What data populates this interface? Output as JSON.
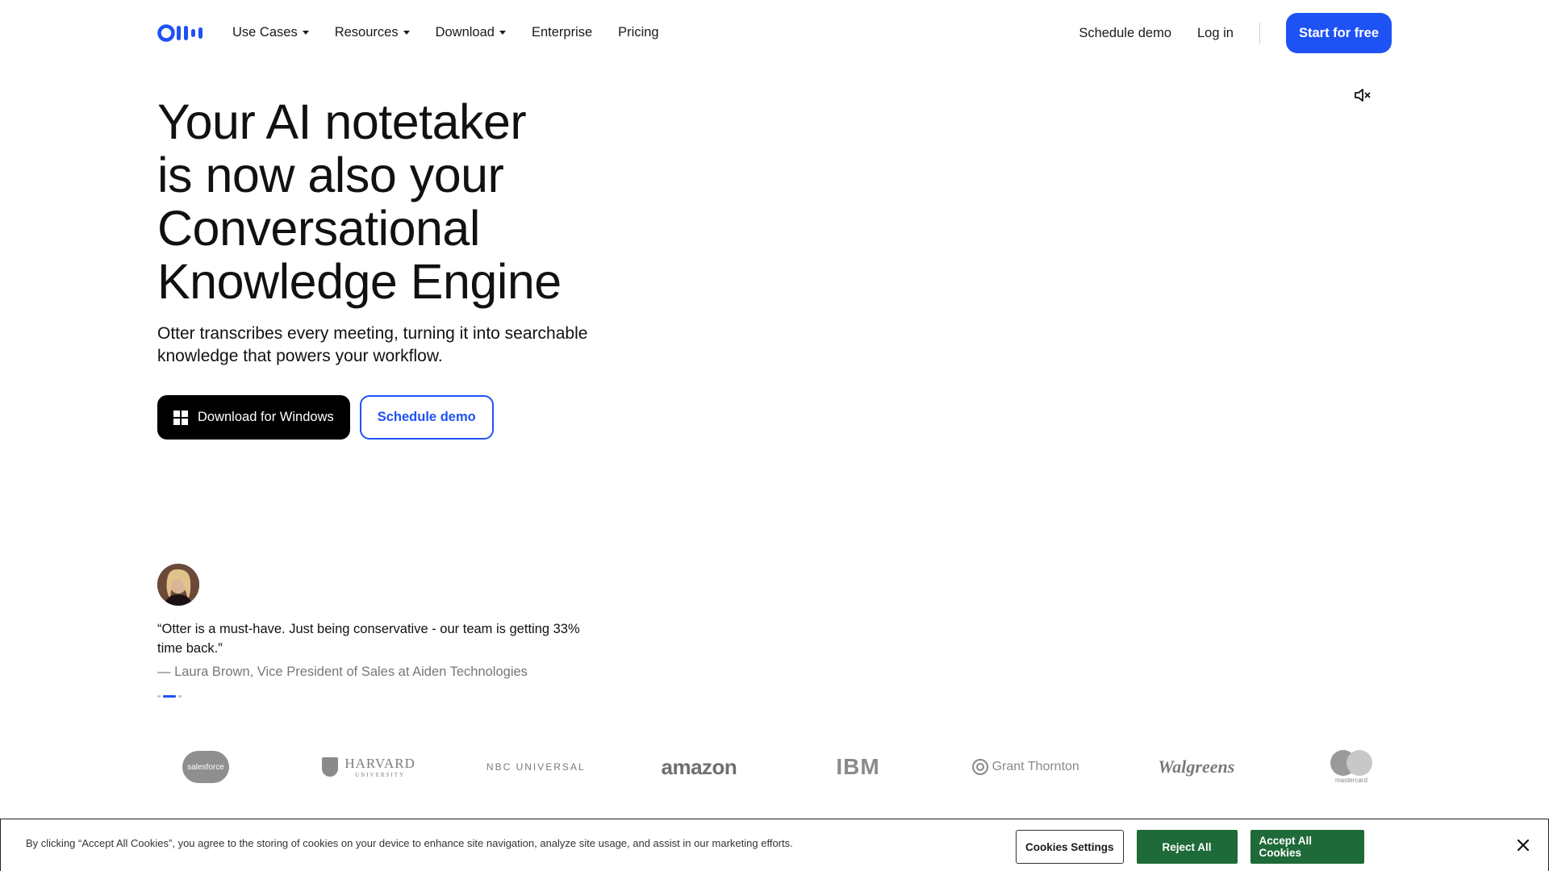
{
  "nav": {
    "logo_icon": "otter-logo-icon",
    "links": [
      {
        "label": "Use Cases",
        "has_dropdown": true
      },
      {
        "label": "Resources",
        "has_dropdown": true
      },
      {
        "label": "Download",
        "has_dropdown": true
      },
      {
        "label": "Enterprise",
        "has_dropdown": false
      },
      {
        "label": "Pricing",
        "has_dropdown": false
      }
    ],
    "schedule_demo": "Schedule demo",
    "log_in": "Log in",
    "start_free": "Start for free"
  },
  "hero": {
    "title_lines": [
      "Your AI notetaker",
      "is now also your",
      "Conversational",
      "Knowledge Engine"
    ],
    "subtitle": "Otter transcribes every meeting, turning it into searchable knowledge that powers your workflow.",
    "download_button": "Download for Windows",
    "demo_button": "Schedule demo",
    "mute_icon": "speaker-muted-icon"
  },
  "testimonial": {
    "quote": "“Otter is a must-have. Just being conservative - our team is getting 33% time back.”",
    "author": "— Laura Brown, Vice President of Sales at Aiden Technologies",
    "slides": 3,
    "active_slide": 2
  },
  "logos": {
    "salesforce": "salesforce",
    "harvard": "HARVARD",
    "harvard_sub": "UNIVERSITY",
    "nbc": "NBC UNIVERSAL",
    "amazon": "amazon",
    "ibm": "IBM",
    "grant_thornton": "Grant Thornton",
    "walgreens": "Walgreens",
    "mastercard": "mastercard"
  },
  "cookie": {
    "text": "By clicking “Accept All Cookies”, you agree to the storing of cookies on your device to enhance site navigation, analyze site usage, and assist in our marketing efforts.",
    "settings": "Cookies Settings",
    "reject": "Reject All",
    "accept": "Accept All Cookies"
  },
  "colors": {
    "accent": "#1f52f5",
    "cookie_green": "#1e6a38"
  }
}
